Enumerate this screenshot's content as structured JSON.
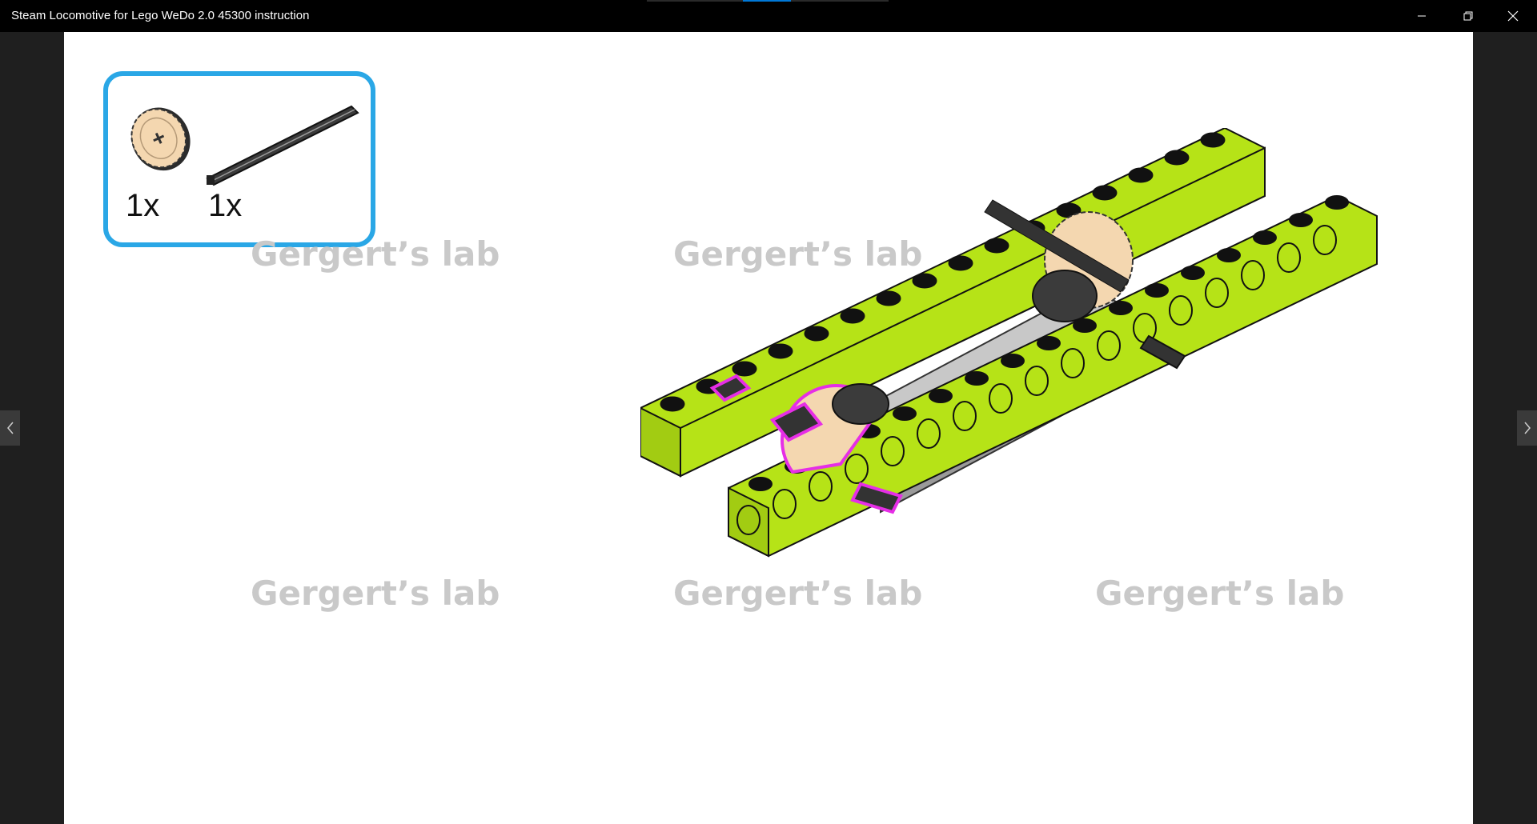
{
  "window": {
    "title": "Steam Locomotive for Lego WeDo 2.0 45300 instruction",
    "accent_color": "#0078d7",
    "controls": {
      "minimize_icon": "minimize-icon",
      "restore_icon": "restore-icon",
      "close_icon": "close-icon"
    }
  },
  "navigation": {
    "prev_icon": "chevron-left-icon",
    "next_icon": "chevron-right-icon"
  },
  "parts_list": {
    "border_color": "#2aa7e6",
    "items": [
      {
        "part": "gear",
        "quantity": "1x"
      },
      {
        "part": "axle",
        "quantity": "1x"
      }
    ]
  },
  "watermarks": [
    "Gergert’s lab",
    "Gergert’s lab",
    "Gergert’s lab",
    "Gergert’s lab",
    "Gergert’s lab"
  ],
  "colors": {
    "brick": "#b6e317",
    "highlight": "#e62ee6",
    "gear": "#f4d7b0",
    "axle": "#333333",
    "grey_plate": "#b9b9b9"
  }
}
